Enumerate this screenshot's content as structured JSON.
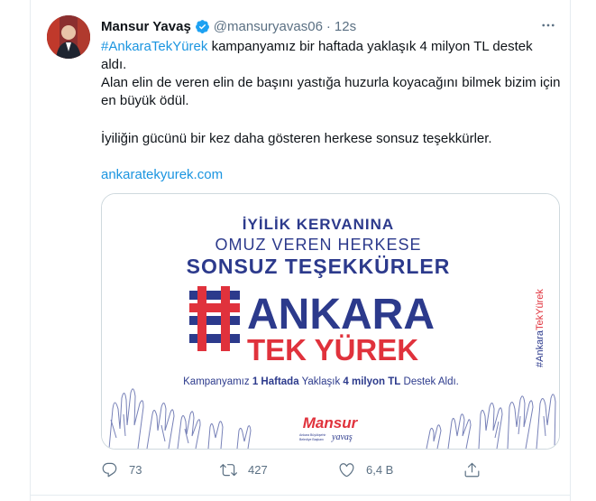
{
  "tweet": {
    "author_name": "Mansur Yavaş",
    "handle": "@mansuryavas06",
    "separator": "·",
    "time": "12s",
    "hashtag": "#AnkaraTekYürek",
    "line1_rest": " kampanyamız bir haftada yaklaşık 4 milyon TL destek aldı.",
    "paragraph2": "Alan elin de veren elin de başını yastığa huzurla koyacağını bilmek bizim için en büyük ödül.",
    "paragraph3": "İyiliğin gücünü bir kez daha gösteren herkese sonsuz teşekkürler.",
    "link": "ankaratekyurek.com"
  },
  "card": {
    "line1": "İYİLİK KERVANINA",
    "line2": "OMUZ VEREN HERKESE",
    "line3": "SONSUZ TEŞEKKÜRLER",
    "brand1": "ANKARA",
    "brand2": "TEK YÜREK",
    "side_hashtag_a": "#Ankara",
    "side_hashtag_b": "TekYürek",
    "subtitle_a": "Kampanyamız ",
    "subtitle_b": "1 Haftada",
    "subtitle_c": " Yaklaşık ",
    "subtitle_d": "4 milyon TL",
    "subtitle_e": " Destek Aldı.",
    "logo_name": "Mansur",
    "logo_sub": "yavaş",
    "logo_small1": "Ankara Büyükşehir",
    "logo_small2": "Belediye Başkanı"
  },
  "actions": {
    "reply_count": "73",
    "retweet_count": "427",
    "like_count": "6,4 B"
  },
  "colors": {
    "link": "#1b95e0",
    "navy": "#2c3a8c",
    "red": "#e0323c",
    "muted": "#5b7083"
  }
}
